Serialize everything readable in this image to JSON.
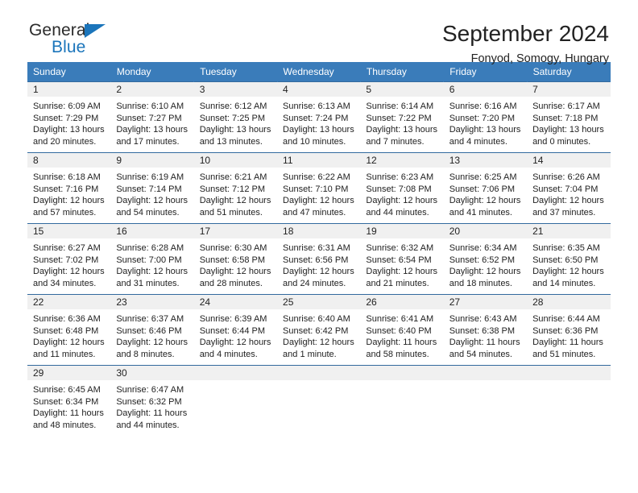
{
  "brand": {
    "name_dark": "General",
    "name_blue": "Blue",
    "accent_color": "#1b75bb"
  },
  "header": {
    "title": "September 2024",
    "subtitle": "Fonyod, Somogy, Hungary"
  },
  "theme": {
    "header_row_bg": "#3a7cba",
    "daynum_bg": "#f0f0f0",
    "row_divider": "#336a9e"
  },
  "weekday_headers": [
    "Sunday",
    "Monday",
    "Tuesday",
    "Wednesday",
    "Thursday",
    "Friday",
    "Saturday"
  ],
  "weeks": [
    [
      {
        "day": "1",
        "sunrise": "Sunrise: 6:09 AM",
        "sunset": "Sunset: 7:29 PM",
        "daylight": "Daylight: 13 hours and 20 minutes."
      },
      {
        "day": "2",
        "sunrise": "Sunrise: 6:10 AM",
        "sunset": "Sunset: 7:27 PM",
        "daylight": "Daylight: 13 hours and 17 minutes."
      },
      {
        "day": "3",
        "sunrise": "Sunrise: 6:12 AM",
        "sunset": "Sunset: 7:25 PM",
        "daylight": "Daylight: 13 hours and 13 minutes."
      },
      {
        "day": "4",
        "sunrise": "Sunrise: 6:13 AM",
        "sunset": "Sunset: 7:24 PM",
        "daylight": "Daylight: 13 hours and 10 minutes."
      },
      {
        "day": "5",
        "sunrise": "Sunrise: 6:14 AM",
        "sunset": "Sunset: 7:22 PM",
        "daylight": "Daylight: 13 hours and 7 minutes."
      },
      {
        "day": "6",
        "sunrise": "Sunrise: 6:16 AM",
        "sunset": "Sunset: 7:20 PM",
        "daylight": "Daylight: 13 hours and 4 minutes."
      },
      {
        "day": "7",
        "sunrise": "Sunrise: 6:17 AM",
        "sunset": "Sunset: 7:18 PM",
        "daylight": "Daylight: 13 hours and 0 minutes."
      }
    ],
    [
      {
        "day": "8",
        "sunrise": "Sunrise: 6:18 AM",
        "sunset": "Sunset: 7:16 PM",
        "daylight": "Daylight: 12 hours and 57 minutes."
      },
      {
        "day": "9",
        "sunrise": "Sunrise: 6:19 AM",
        "sunset": "Sunset: 7:14 PM",
        "daylight": "Daylight: 12 hours and 54 minutes."
      },
      {
        "day": "10",
        "sunrise": "Sunrise: 6:21 AM",
        "sunset": "Sunset: 7:12 PM",
        "daylight": "Daylight: 12 hours and 51 minutes."
      },
      {
        "day": "11",
        "sunrise": "Sunrise: 6:22 AM",
        "sunset": "Sunset: 7:10 PM",
        "daylight": "Daylight: 12 hours and 47 minutes."
      },
      {
        "day": "12",
        "sunrise": "Sunrise: 6:23 AM",
        "sunset": "Sunset: 7:08 PM",
        "daylight": "Daylight: 12 hours and 44 minutes."
      },
      {
        "day": "13",
        "sunrise": "Sunrise: 6:25 AM",
        "sunset": "Sunset: 7:06 PM",
        "daylight": "Daylight: 12 hours and 41 minutes."
      },
      {
        "day": "14",
        "sunrise": "Sunrise: 6:26 AM",
        "sunset": "Sunset: 7:04 PM",
        "daylight": "Daylight: 12 hours and 37 minutes."
      }
    ],
    [
      {
        "day": "15",
        "sunrise": "Sunrise: 6:27 AM",
        "sunset": "Sunset: 7:02 PM",
        "daylight": "Daylight: 12 hours and 34 minutes."
      },
      {
        "day": "16",
        "sunrise": "Sunrise: 6:28 AM",
        "sunset": "Sunset: 7:00 PM",
        "daylight": "Daylight: 12 hours and 31 minutes."
      },
      {
        "day": "17",
        "sunrise": "Sunrise: 6:30 AM",
        "sunset": "Sunset: 6:58 PM",
        "daylight": "Daylight: 12 hours and 28 minutes."
      },
      {
        "day": "18",
        "sunrise": "Sunrise: 6:31 AM",
        "sunset": "Sunset: 6:56 PM",
        "daylight": "Daylight: 12 hours and 24 minutes."
      },
      {
        "day": "19",
        "sunrise": "Sunrise: 6:32 AM",
        "sunset": "Sunset: 6:54 PM",
        "daylight": "Daylight: 12 hours and 21 minutes."
      },
      {
        "day": "20",
        "sunrise": "Sunrise: 6:34 AM",
        "sunset": "Sunset: 6:52 PM",
        "daylight": "Daylight: 12 hours and 18 minutes."
      },
      {
        "day": "21",
        "sunrise": "Sunrise: 6:35 AM",
        "sunset": "Sunset: 6:50 PM",
        "daylight": "Daylight: 12 hours and 14 minutes."
      }
    ],
    [
      {
        "day": "22",
        "sunrise": "Sunrise: 6:36 AM",
        "sunset": "Sunset: 6:48 PM",
        "daylight": "Daylight: 12 hours and 11 minutes."
      },
      {
        "day": "23",
        "sunrise": "Sunrise: 6:37 AM",
        "sunset": "Sunset: 6:46 PM",
        "daylight": "Daylight: 12 hours and 8 minutes."
      },
      {
        "day": "24",
        "sunrise": "Sunrise: 6:39 AM",
        "sunset": "Sunset: 6:44 PM",
        "daylight": "Daylight: 12 hours and 4 minutes."
      },
      {
        "day": "25",
        "sunrise": "Sunrise: 6:40 AM",
        "sunset": "Sunset: 6:42 PM",
        "daylight": "Daylight: 12 hours and 1 minute."
      },
      {
        "day": "26",
        "sunrise": "Sunrise: 6:41 AM",
        "sunset": "Sunset: 6:40 PM",
        "daylight": "Daylight: 11 hours and 58 minutes."
      },
      {
        "day": "27",
        "sunrise": "Sunrise: 6:43 AM",
        "sunset": "Sunset: 6:38 PM",
        "daylight": "Daylight: 11 hours and 54 minutes."
      },
      {
        "day": "28",
        "sunrise": "Sunrise: 6:44 AM",
        "sunset": "Sunset: 6:36 PM",
        "daylight": "Daylight: 11 hours and 51 minutes."
      }
    ],
    [
      {
        "day": "29",
        "sunrise": "Sunrise: 6:45 AM",
        "sunset": "Sunset: 6:34 PM",
        "daylight": "Daylight: 11 hours and 48 minutes."
      },
      {
        "day": "30",
        "sunrise": "Sunrise: 6:47 AM",
        "sunset": "Sunset: 6:32 PM",
        "daylight": "Daylight: 11 hours and 44 minutes."
      },
      {
        "day": "",
        "sunrise": "",
        "sunset": "",
        "daylight": ""
      },
      {
        "day": "",
        "sunrise": "",
        "sunset": "",
        "daylight": ""
      },
      {
        "day": "",
        "sunrise": "",
        "sunset": "",
        "daylight": ""
      },
      {
        "day": "",
        "sunrise": "",
        "sunset": "",
        "daylight": ""
      },
      {
        "day": "",
        "sunrise": "",
        "sunset": "",
        "daylight": ""
      }
    ]
  ]
}
